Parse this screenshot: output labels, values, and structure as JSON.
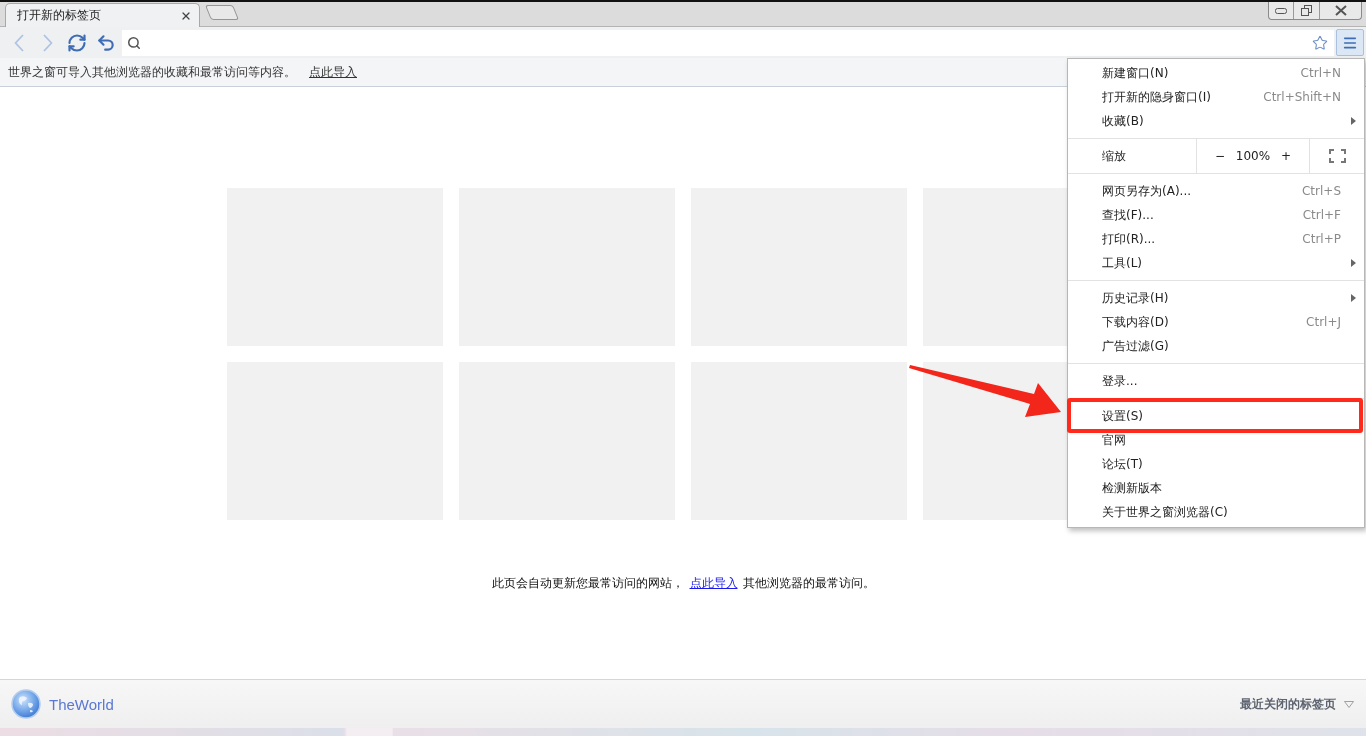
{
  "tabs": [
    {
      "title": "打开新的标签页",
      "selected": true
    }
  ],
  "toolbar": {
    "nav_buttons": [
      {
        "kind": "back",
        "disabled": true
      },
      {
        "kind": "forward",
        "disabled": true
      },
      {
        "kind": "reload",
        "disabled": false
      },
      {
        "kind": "undo",
        "disabled": false
      }
    ]
  },
  "info_bar": {
    "text": "世界之窗可导入其他浏览器的收藏和最常访问等内容。",
    "link": "点此导入"
  },
  "most_visited": {
    "tiles": [
      {
        "kind": "placeholder"
      },
      {
        "kind": "placeholder"
      },
      {
        "kind": "placeholder"
      },
      {
        "kind": "placeholder"
      },
      {
        "kind": "placeholder"
      },
      {
        "kind": "placeholder"
      },
      {
        "kind": "placeholder"
      },
      {
        "kind": "placeholder"
      }
    ]
  },
  "hint": {
    "before": "此页会自动更新您最常访问的网站，",
    "link": "点此导入",
    "after": "其他浏览器的最常访问。"
  },
  "footer": {
    "brand": "TheWorld",
    "recent_tabs": "最近关闭的标签页"
  },
  "menu": {
    "open": true,
    "sections": [
      {
        "kind": "items",
        "items": [
          {
            "label": "新建窗口(N)",
            "shortcut": "Ctrl+N",
            "submenu": false,
            "highlighted": false
          },
          {
            "label": "打开新的隐身窗口(I)",
            "shortcut": "Ctrl+Shift+N",
            "submenu": false,
            "highlighted": false
          },
          {
            "label": "收藏(B)",
            "submenu": true,
            "highlighted": false
          }
        ]
      },
      {
        "kind": "zoom",
        "label": "缩放",
        "minus": "−",
        "value": "100%",
        "plus": "+"
      },
      {
        "kind": "items",
        "items": [
          {
            "label": "网页另存为(A)...",
            "shortcut": "Ctrl+S",
            "submenu": false,
            "highlighted": false
          },
          {
            "label": "查找(F)...",
            "shortcut": "Ctrl+F",
            "submenu": false,
            "highlighted": false
          },
          {
            "label": "打印(R)...",
            "shortcut": "Ctrl+P",
            "submenu": false,
            "highlighted": false
          },
          {
            "label": "工具(L)",
            "submenu": true,
            "highlighted": false
          }
        ]
      },
      {
        "kind": "items",
        "items": [
          {
            "label": "历史记录(H)",
            "submenu": true,
            "highlighted": false
          },
          {
            "label": "下载内容(D)",
            "shortcut": "Ctrl+J",
            "submenu": false,
            "highlighted": false
          },
          {
            "label": "广告过滤(G)",
            "submenu": false,
            "highlighted": false
          }
        ]
      },
      {
        "kind": "items",
        "items": [
          {
            "label": "登录...",
            "submenu": false,
            "highlighted": false
          }
        ]
      },
      {
        "kind": "items",
        "items": [
          {
            "label": "设置(S)",
            "submenu": false,
            "highlighted": true
          },
          {
            "label": "官网",
            "submenu": false,
            "highlighted": false
          },
          {
            "label": "论坛(T)",
            "submenu": false,
            "highlighted": false
          },
          {
            "label": "检测新版本",
            "submenu": false,
            "highlighted": false
          },
          {
            "label": "关于世界之窗浏览器(C)",
            "submenu": false,
            "highlighted": false
          }
        ]
      }
    ]
  }
}
